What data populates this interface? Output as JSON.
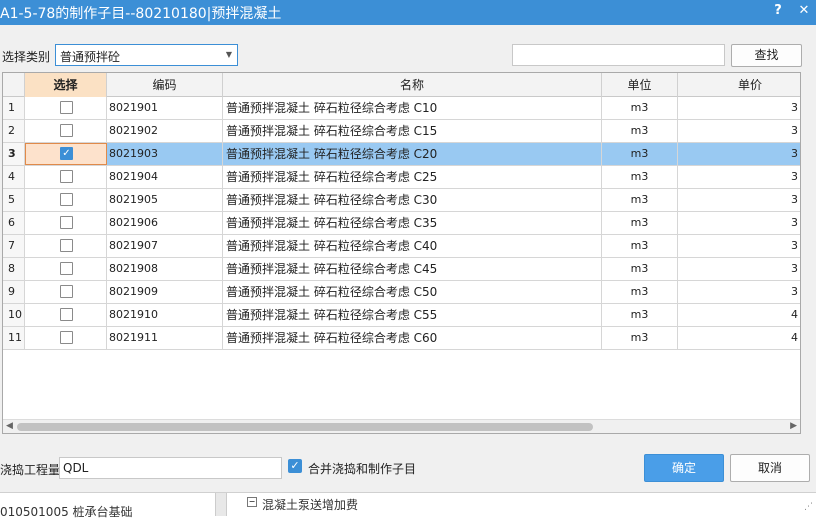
{
  "window": {
    "title": "A1-5-78的制作子目--80210180|预拌混凝土",
    "help_label": "?",
    "close_label": "✕"
  },
  "filter": {
    "category_label": "选择类别",
    "category_value": "普通预拌砼",
    "search_value": "",
    "search_button": "查找"
  },
  "table": {
    "columns": [
      "选择",
      "编码",
      "名称",
      "单位",
      "单价"
    ],
    "rows": [
      {
        "no": "1",
        "checked": false,
        "code": "8021901",
        "name": "普通预拌混凝土 碎石粒径综合考虑 C10",
        "unit": "m3",
        "price": "3"
      },
      {
        "no": "2",
        "checked": false,
        "code": "8021902",
        "name": "普通预拌混凝土 碎石粒径综合考虑 C15",
        "unit": "m3",
        "price": "3"
      },
      {
        "no": "3",
        "checked": true,
        "selected": true,
        "code": "8021903",
        "name": "普通预拌混凝土 碎石粒径综合考虑 C20",
        "unit": "m3",
        "price": "3"
      },
      {
        "no": "4",
        "checked": false,
        "code": "8021904",
        "name": "普通预拌混凝土 碎石粒径综合考虑 C25",
        "unit": "m3",
        "price": "3"
      },
      {
        "no": "5",
        "checked": false,
        "code": "8021905",
        "name": "普通预拌混凝土 碎石粒径综合考虑 C30",
        "unit": "m3",
        "price": "3"
      },
      {
        "no": "6",
        "checked": false,
        "code": "8021906",
        "name": "普通预拌混凝土 碎石粒径综合考虑 C35",
        "unit": "m3",
        "price": "3"
      },
      {
        "no": "7",
        "checked": false,
        "code": "8021907",
        "name": "普通预拌混凝土 碎石粒径综合考虑 C40",
        "unit": "m3",
        "price": "3"
      },
      {
        "no": "8",
        "checked": false,
        "code": "8021908",
        "name": "普通预拌混凝土 碎石粒径综合考虑 C45",
        "unit": "m3",
        "price": "3"
      },
      {
        "no": "9",
        "checked": false,
        "code": "8021909",
        "name": "普通预拌混凝土 碎石粒径综合考虑 C50",
        "unit": "m3",
        "price": "3"
      },
      {
        "no": "10",
        "checked": false,
        "code": "8021910",
        "name": "普通预拌混凝土 碎石粒径综合考虑 C55",
        "unit": "m3",
        "price": "4"
      },
      {
        "no": "11",
        "checked": false,
        "code": "8021911",
        "name": "普通预拌混凝土 碎石粒径综合考虑 C60",
        "unit": "m3",
        "price": "4"
      }
    ]
  },
  "footer": {
    "qty_label": "浇捣工程量",
    "qty_value": "QDL",
    "merge_label": "合并浇捣和制作子目",
    "merge_checked": true,
    "ok_button": "确定",
    "cancel_button": "取消"
  },
  "background": {
    "left_text": "010501005  桩承台基础",
    "right_text": "混凝土泵送增加费"
  },
  "colors": {
    "accent": "#3c8fd6",
    "selected_row": "#99c9f2",
    "primary_button": "#4a9ee8"
  }
}
